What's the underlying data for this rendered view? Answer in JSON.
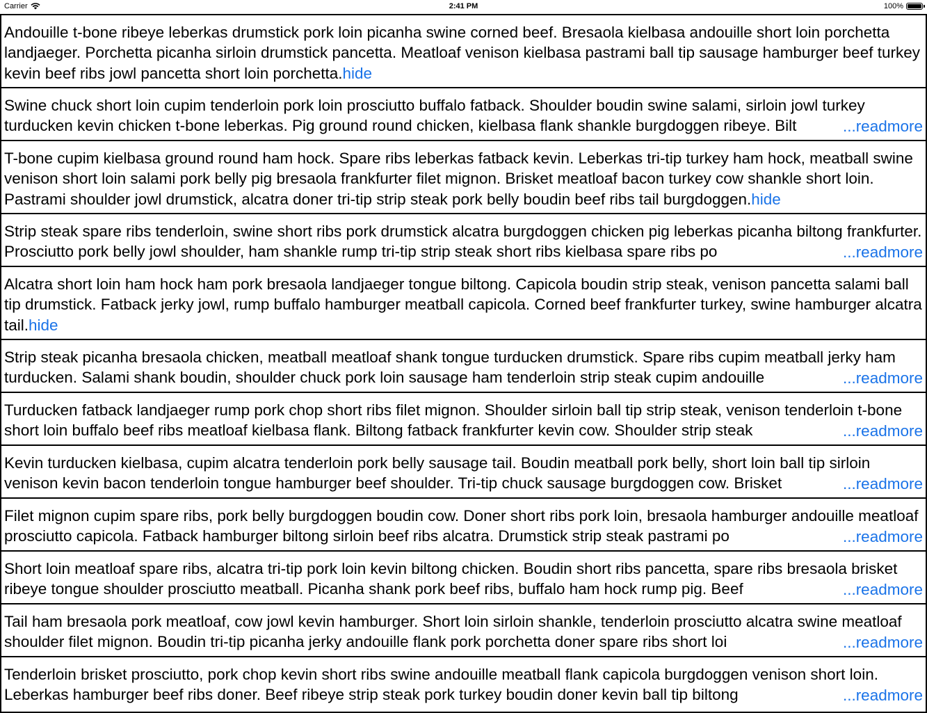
{
  "status_bar": {
    "carrier": "Carrier",
    "time": "2:41 PM",
    "battery": "100%"
  },
  "rows": [
    {
      "text": "Andouille t-bone ribeye leberkas drumstick pork loin picanha swine corned beef.  Bresaola kielbasa andouille short loin porchetta landjaeger.  Porchetta picanha sirloin drumstick pancetta.  Meatloaf venison kielbasa pastrami ball tip sausage hamburger beef turkey kevin beef ribs jowl pancetta short loin porchetta.",
      "link": "hide"
    },
    {
      "text": "Swine chuck short loin cupim tenderloin pork loin prosciutto buffalo fatback.  Shoulder boudin swine salami, sirloin jowl turkey turducken kevin chicken t-bone leberkas.  Pig ground round chicken, kielbasa flank shankle burgdoggen ribeye.  Bilt",
      "link": "...readmore"
    },
    {
      "text": "T-bone cupim kielbasa ground round ham hock.  Spare ribs leberkas fatback kevin.  Leberkas tri-tip turkey ham hock, meatball swine venison short loin salami pork belly pig bresaola frankfurter filet mignon.  Brisket meatloaf bacon turkey cow shankle short loin.  Pastrami shoulder jowl drumstick, alcatra doner tri-tip strip steak pork belly boudin beef ribs tail burgdoggen.",
      "link": "hide"
    },
    {
      "text": "Strip steak spare ribs tenderloin, swine short ribs pork drumstick alcatra burgdoggen chicken pig leberkas picanha biltong frankfurter.  Prosciutto pork belly jowl shoulder, ham shankle rump tri-tip strip steak short ribs kielbasa spare ribs po",
      "link": "...readmore"
    },
    {
      "text": "Alcatra short loin ham hock ham pork bresaola landjaeger tongue biltong.  Capicola boudin strip steak, venison pancetta salami ball tip drumstick.  Fatback jerky jowl, rump buffalo hamburger meatball capicola.  Corned beef frankfurter turkey, swine hamburger alcatra tail.",
      "link": "hide"
    },
    {
      "text": "Strip steak picanha bresaola chicken, meatball meatloaf shank tongue turducken drumstick.  Spare ribs cupim meatball jerky ham turducken.  Salami shank boudin, shoulder chuck pork loin sausage ham tenderloin strip steak cupim andouille ",
      "link": "...readmore"
    },
    {
      "text": "Turducken fatback landjaeger rump pork chop short ribs filet mignon.  Shoulder sirloin ball tip strip steak, venison tenderloin t-bone short loin buffalo beef ribs meatloaf kielbasa flank.  Biltong fatback frankfurter kevin cow.  Shoulder strip steak",
      "link": "...readmore"
    },
    {
      "text": "Kevin turducken kielbasa, cupim alcatra tenderloin pork belly sausage tail.  Boudin meatball pork belly, short loin ball tip sirloin venison kevin bacon tenderloin tongue hamburger beef shoulder.  Tri-tip chuck sausage burgdoggen cow.  Brisket ",
      "link": "...readmore"
    },
    {
      "text": "Filet mignon cupim spare ribs, pork belly burgdoggen boudin cow.  Doner short ribs pork loin, bresaola hamburger andouille meatloaf prosciutto capicola.  Fatback hamburger biltong sirloin beef ribs alcatra.  Drumstick strip steak pastrami po",
      "link": "...readmore"
    },
    {
      "text": "Short loin meatloaf spare ribs, alcatra tri-tip pork loin kevin biltong chicken.  Boudin short ribs pancetta, spare ribs bresaola brisket ribeye tongue shoulder prosciutto meatball.  Picanha shank pork beef ribs, buffalo ham hock rump pig.  Beef ",
      "link": "...readmore"
    },
    {
      "text": "Tail ham bresaola pork meatloaf, cow jowl kevin hamburger.  Short loin sirloin shankle, tenderloin prosciutto alcatra swine meatloaf shoulder filet mignon.  Boudin tri-tip picanha jerky andouille flank pork porchetta doner spare ribs short loi",
      "link": "...readmore"
    },
    {
      "text": "Tenderloin brisket prosciutto, pork chop kevin short ribs swine andouille meatball flank capicola burgdoggen venison short loin.  Leberkas hamburger beef ribs doner.  Beef ribeye strip steak pork turkey boudin doner kevin ball tip biltong ",
      "link": "...readmore"
    }
  ]
}
